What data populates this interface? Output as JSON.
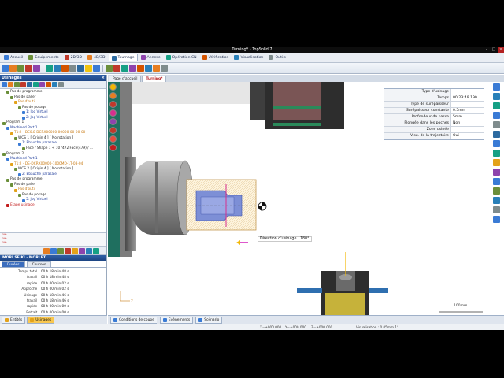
{
  "window": {
    "title": "Turning* - TopSolid 7"
  },
  "ribbon": {
    "tabs": [
      {
        "label": "Accueil",
        "color": "#3a7bd5"
      },
      {
        "label": "Equipements",
        "color": "#6b8f3a"
      },
      {
        "label": "2D/3D",
        "color": "#c0392b"
      },
      {
        "label": "4D/3D",
        "color": "#e67e22"
      },
      {
        "label": "Tournage",
        "color": "#2c6aa0",
        "active": true
      },
      {
        "label": "Annexe",
        "color": "#8e44ad"
      },
      {
        "label": "Opération CN",
        "color": "#16a085"
      },
      {
        "label": "Vérification",
        "color": "#d35400"
      },
      {
        "label": "Visualisation",
        "color": "#2980b9"
      },
      {
        "label": "Outils",
        "color": "#7f8c8d"
      }
    ]
  },
  "left_panel": {
    "title": "Usinages",
    "tree": [
      {
        "indent": 1,
        "label": "Pas de programme",
        "color": "dark"
      },
      {
        "indent": 2,
        "label": "Pas de palier",
        "color": "dark"
      },
      {
        "indent": 3,
        "label": "Pas d'outil",
        "color": "orange"
      },
      {
        "indent": 4,
        "label": "Pas de posage",
        "color": "dark"
      },
      {
        "indent": 5,
        "label": "1: Jog Virtuel",
        "color": "blue"
      },
      {
        "indent": 5,
        "label": "2: Jog Virtuel",
        "color": "blue"
      },
      {
        "indent": 0,
        "label": "Program 1",
        "color": "dark"
      },
      {
        "indent": 1,
        "label": "Machined Part 1",
        "color": "blue"
      },
      {
        "indent": 2,
        "label": "T1:2 - DE0.8-DCRX00000-00000-00-00-00",
        "color": "orange"
      },
      {
        "indent": 3,
        "label": "WCS 1 [ Origin 4 ] [ No rotation ]",
        "color": "dark"
      },
      {
        "indent": 4,
        "label": "1: Ebauche parasale...",
        "color": "blue"
      },
      {
        "indent": 5,
        "label": "Face / Shape 1 < 107472 Face(479) / ...",
        "color": "dark"
      },
      {
        "indent": 0,
        "label": "Program 2",
        "color": "dark"
      },
      {
        "indent": 1,
        "label": "Machined Part 1",
        "color": "blue"
      },
      {
        "indent": 2,
        "label": "T1:2 - DE-DCRX00000-1000MD-1T-08-04",
        "color": "orange"
      },
      {
        "indent": 3,
        "label": "WCS 2 [ Origin 4 ] [ No rotation ]",
        "color": "dark"
      },
      {
        "indent": 4,
        "label": "2: Ebauche parasale",
        "color": "blue"
      },
      {
        "indent": 1,
        "label": "Pas de programme",
        "color": "dark"
      },
      {
        "indent": 2,
        "label": "Pas de palier",
        "color": "dark"
      },
      {
        "indent": 3,
        "label": "Pas d'outil",
        "color": "orange"
      },
      {
        "indent": 4,
        "label": "Pas de posage",
        "color": "dark"
      },
      {
        "indent": 5,
        "label": "5: Jog Virtuel",
        "color": "blue"
      },
      {
        "indent": 1,
        "label": "Etape usinage",
        "color": "red"
      }
    ],
    "filter_lines": [
      "Filtr",
      "Filtr",
      "Filtr"
    ]
  },
  "machine": {
    "title": "MORI SEIKI - MORLET",
    "tabs": [
      {
        "label": "Durées",
        "active": true
      },
      {
        "label": "Courses",
        "active": false
      }
    ],
    "times": [
      {
        "label": "Temps total :",
        "value": "00 h 18 min 48 s"
      },
      {
        "label": "travail :",
        "value": "00 h 18 min 48 s"
      },
      {
        "label": "rapide :",
        "value": "00 h 00 min 02 s"
      },
      {
        "label": "Approche :",
        "value": "00 h 00 min 02 s"
      },
      {
        "label": "Usinage :",
        "value": "00 h 18 min 46 s"
      },
      {
        "label": "travail :",
        "value": "00 h 18 min 46 s"
      },
      {
        "label": "rapide :",
        "value": "00 h 00 min 00 s"
      },
      {
        "label": "Retrait :",
        "value": "00 h 00 min 00 s"
      }
    ]
  },
  "left_bottom_tabs": [
    {
      "label": "Entités",
      "active": false
    },
    {
      "label": "Usinages",
      "active": true
    }
  ],
  "document_tabs": [
    {
      "label": "Page d'accueil",
      "active": false
    },
    {
      "label": "Turning*",
      "active": true
    }
  ],
  "properties": [
    {
      "label": "Type d'usinage",
      "value": ""
    },
    {
      "label": "Temps",
      "value": "00:23:49.190"
    },
    {
      "label": "Type de surépaisseur",
      "value": ""
    },
    {
      "label": "Surépaisseur constante",
      "value": "0.5mm"
    },
    {
      "label": "Profondeur de passe",
      "value": "5mm"
    },
    {
      "label": "Plongée dans les poches",
      "value": "Non"
    },
    {
      "label": "Zone usinée",
      "value": ""
    },
    {
      "label": "Visu. de la trajectoire",
      "value": "Oui"
    }
  ],
  "viewport": {
    "direction_label": "Direction d'usinage",
    "direction_value": "180°",
    "scale_label": "100mm",
    "axis_x": "Z",
    "axis_y": "X"
  },
  "status_buttons": [
    {
      "label": "Conditions de coupe"
    },
    {
      "label": "Evènements"
    },
    {
      "label": "Scénario"
    }
  ],
  "coordinates": {
    "x": "X=+000.000",
    "y": "Y=+000.000",
    "z": "Z=+000.000",
    "visualisation": "Visualisation : 0.05mm 1°"
  },
  "colors": {
    "accent": "#1d4584",
    "active_tab_text": "#b2161b",
    "machine_green": "#2a8a5a",
    "chuck_gray": "#9a9a9a",
    "part_blue": "#7d8fd6"
  }
}
